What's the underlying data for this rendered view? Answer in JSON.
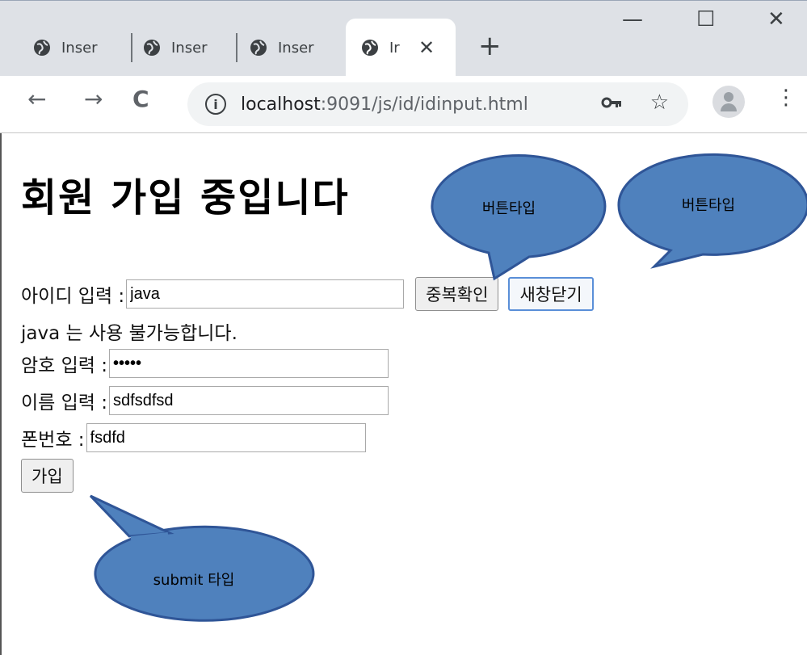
{
  "browser": {
    "tabs": [
      {
        "label": "Inser"
      },
      {
        "label": "Inser"
      },
      {
        "label": "Inser"
      },
      {
        "label": "Ir"
      }
    ],
    "new_tab": "+",
    "minimize": "—",
    "maximize": "☐",
    "close": "✕",
    "tab_close": "✕",
    "url_host": "localhost",
    "url_path": ":9091/js/id/idinput.html",
    "icons": [
      "globe-icon",
      "info-icon",
      "key-icon",
      "star-icon",
      "avatar-icon",
      "menu-icon"
    ]
  },
  "page": {
    "heading": "회원 가입 중입니다",
    "id_label": "아이디 입력 : ",
    "id_value": "java",
    "dup_check_button": "중복확인",
    "close_window_button": "새창닫기",
    "id_status": "java 는 사용 불가능합니다.",
    "pw_label": "암호 입력 : ",
    "pw_value": "•••••",
    "name_label": "이름 입력 : ",
    "name_value": "sdfsdfsd",
    "phone_label": "폰번호 : ",
    "phone_value": "fsdfd",
    "join_button": "가입"
  },
  "callouts": {
    "dup_button_type": "버튼타입",
    "close_button_type": "버튼타입",
    "join_button_type": "submit 타입",
    "fill_color": "#4f81bd",
    "stroke_color": "#2f5597"
  }
}
